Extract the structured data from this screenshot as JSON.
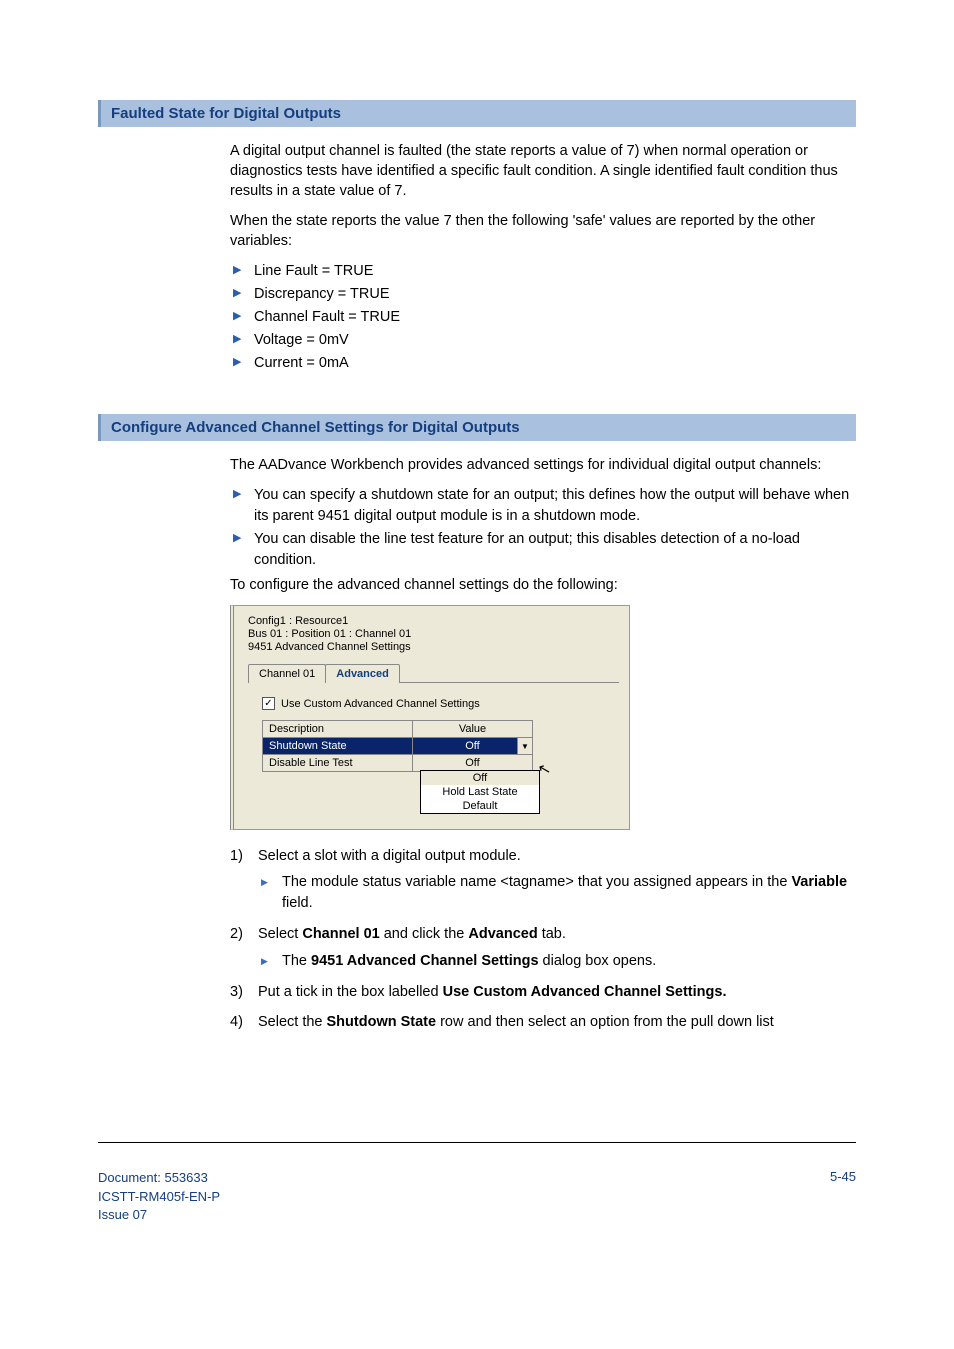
{
  "section1": {
    "title": "Faulted State for Digital Outputs",
    "p1": "A digital output channel is faulted (the state reports a value of 7) when normal operation or diagnostics tests have identified a specific fault condition. A single identified fault condition thus results in a state value of 7.",
    "p2": "When the state reports the value 7 then the following 'safe' values are reported by the other variables:",
    "bullets": [
      "Line Fault = TRUE",
      "Discrepancy = TRUE",
      "Channel Fault = TRUE",
      "Voltage = 0mV",
      "Current = 0mA"
    ]
  },
  "section2": {
    "title": "Configure Advanced Channel Settings for Digital Outputs",
    "p1": "The AADvance Workbench provides advanced settings for individual digital output channels:",
    "bullets": [
      "You can specify a shutdown state for an output; this defines how the output will behave when its parent 9451 digital output module is in a shutdown mode.",
      "You can disable the line test feature for an output; this disables detection of a no-load condition."
    ],
    "p2": "To configure the advanced channel settings do the following:"
  },
  "dialog": {
    "line1": "Config1 : Resource1",
    "line2": "Bus 01 : Position 01 : Channel 01",
    "line3": "9451 Advanced Channel Settings",
    "tab1": "Channel 01",
    "tab2": "Advanced",
    "checkbox_label": "Use Custom Advanced Channel Settings",
    "col_desc": "Description",
    "col_val": "Value",
    "row1_desc": "Shutdown State",
    "row1_val": "Off",
    "row2_desc": "Disable Line Test",
    "row2_val": "Off",
    "dd_opt1": "Off",
    "dd_opt2": "Hold Last State",
    "dd_opt3": "Default"
  },
  "steps": {
    "s1": "Select a slot with a digital output module.",
    "s1_sub_a": "The module status variable name <tagname> that you assigned appears in the ",
    "s1_sub_b": "Variable",
    "s1_sub_c": " field.",
    "s2_a": "Select ",
    "s2_b": "Channel 01",
    "s2_c": " and click the ",
    "s2_d": "Advanced",
    "s2_e": " tab.",
    "s2_sub_a": "The ",
    "s2_sub_b": "9451 Advanced Channel Settings",
    "s2_sub_c": " dialog box opens.",
    "s3_a": "Put a tick in the box labelled ",
    "s3_b": "Use Custom Advanced Channel Settings.",
    "s4_a": "Select the ",
    "s4_b": "Shutdown State",
    "s4_c": " row and then select an option from the pull down list"
  },
  "footer": {
    "doc": "Document: 553633",
    "ref": "ICSTT-RM405f-EN-P",
    "issue": "Issue 07",
    "page": "5-45"
  }
}
